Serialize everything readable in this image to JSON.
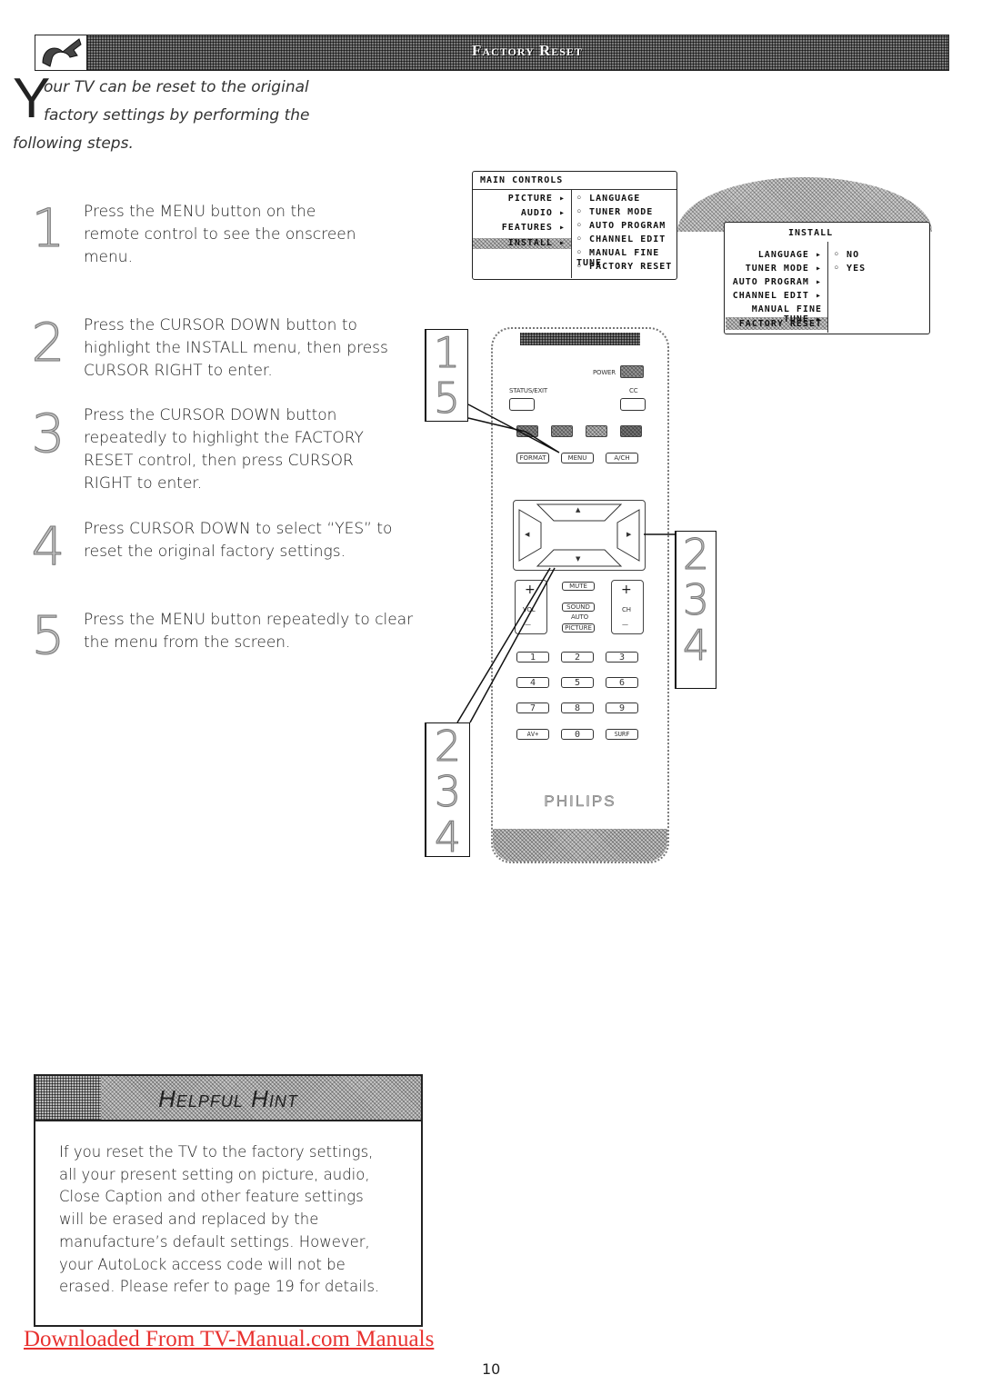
{
  "header": {
    "title": "Factory Reset",
    "icon": "wrench-icon"
  },
  "intro": {
    "drop_cap": "Y",
    "lines": [
      "our TV can be reset to the original",
      "factory settings by performing the",
      "following steps."
    ]
  },
  "steps": [
    {
      "number": "1",
      "lines": [
        "Press the MENU button on the",
        "remote control to see the onscreen",
        "menu."
      ]
    },
    {
      "number": "2",
      "lines": [
        "Press the CURSOR DOWN button to",
        "highlight the INSTALL menu, then press",
        "CURSOR RIGHT to enter."
      ]
    },
    {
      "number": "3",
      "lines": [
        "Press the CURSOR DOWN button",
        "repeatedly to highlight the FACTORY",
        "RESET control, then press CURSOR",
        "RIGHT to enter."
      ]
    },
    {
      "number": "4",
      "lines": [
        "Press CURSOR DOWN to select “YES” to",
        "reset the original factory settings."
      ]
    },
    {
      "number": "5",
      "lines": [
        "Press the MENU button repeatedly to clear",
        "the menu from the screen."
      ]
    }
  ],
  "main_menu": {
    "title": "MAIN CONTROLS",
    "left_items": [
      "PICTURE",
      "AUDIO",
      "FEATURES",
      "INSTALL"
    ],
    "highlighted": "INSTALL",
    "right_items": [
      "LANGUAGE",
      "TUNER MODE",
      "AUTO PROGRAM",
      "CHANNEL EDIT",
      "MANUAL FINE TUNE",
      "FACTORY RESET"
    ]
  },
  "install_menu": {
    "title": "INSTALL",
    "left_items": [
      "LANGUAGE",
      "TUNER MODE",
      "AUTO PROGRAM",
      "CHANNEL EDIT",
      "MANUAL FINE TUNE",
      "FACTORY RESET"
    ],
    "highlighted": "FACTORY RESET",
    "options": [
      "NO",
      "YES"
    ]
  },
  "remote": {
    "power_label": "POWER",
    "status_label": "STATUS/EXIT",
    "cc_label": "CC",
    "row_buttons": [
      "FORMAT",
      "MENU",
      "A/CH"
    ],
    "mute_label": "MUTE",
    "vol_label": "VOL",
    "ch_label": "CH",
    "plus": "+",
    "minus": "—",
    "sound_label": "SOUND",
    "auto_label": "AUTO",
    "picture_label": "PICTURE",
    "arrows": {
      "up": "▲",
      "down": "▼",
      "left": "◀",
      "right": "▶"
    },
    "number_buttons": [
      "1",
      "2",
      "3",
      "4",
      "5",
      "6",
      "7",
      "8",
      "9",
      "AV+",
      "0",
      "SURF"
    ],
    "brand": "PHILIPS"
  },
  "callouts": {
    "top_left": [
      "1",
      "5"
    ],
    "right": [
      "2",
      "3",
      "4"
    ],
    "bottom_left": [
      "2",
      "3",
      "4"
    ]
  },
  "hint": {
    "title": "Helpful Hint",
    "lines": [
      "If you reset the TV to the factory settings,",
      "all your present setting on picture, audio,",
      "Close Caption and other feature settings",
      "will be erased and replaced by the",
      "manufacture’s default settings. However,",
      "your AutoLock access code will not be",
      "erased. Please refer to page 19 for details."
    ]
  },
  "footer": {
    "download_link": "Downloaded From TV-Manual.com Manuals",
    "link_color": "#e8312f",
    "page_number": "10"
  }
}
